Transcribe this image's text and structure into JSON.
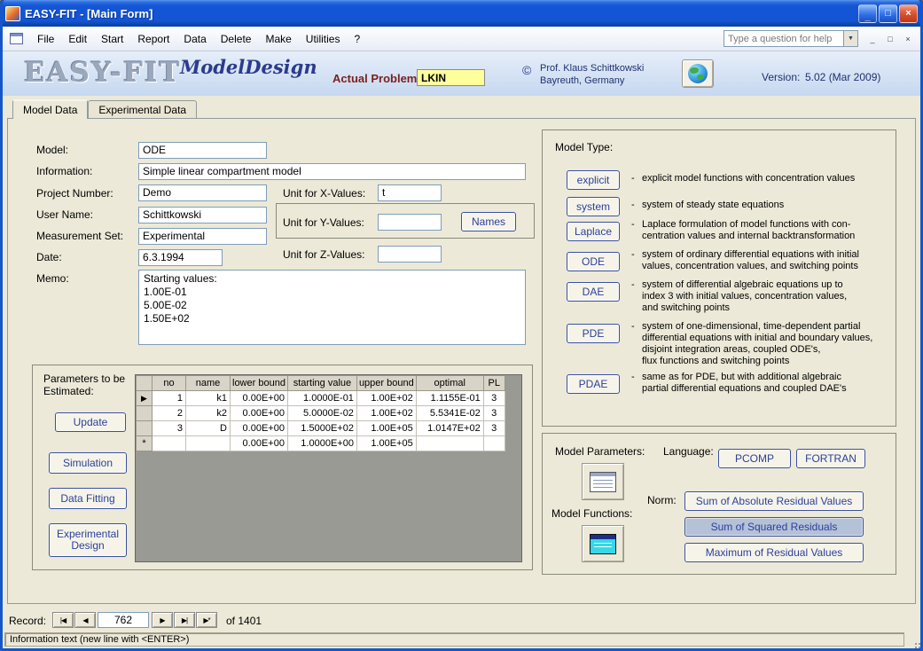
{
  "window": {
    "title": "EASY-FIT - [Main Form]",
    "menu": [
      "File",
      "Edit",
      "Start",
      "Report",
      "Data",
      "Delete",
      "Make",
      "Utilities",
      "?"
    ],
    "help_placeholder": "Type a question for help",
    "controls": {
      "minimize": "_",
      "maximize": "□",
      "close": "×"
    }
  },
  "header": {
    "logo": "EASY-FIT",
    "subtitle": "ModelDesign",
    "actual_problem_label": "Actual Problem:",
    "actual_problem_value": "LKIN",
    "copyright_symbol": "©",
    "author_line1": "Prof. Klaus Schittkowski",
    "author_line2": "Bayreuth, Germany",
    "version_label": "Version:",
    "version_value": "5.02 (Mar 2009)"
  },
  "tabs": [
    {
      "label": "Model Data"
    },
    {
      "label": "Experimental Data"
    }
  ],
  "form": {
    "model_label": "Model:",
    "model_value": "ODE",
    "information_label": "Information:",
    "information_value": "Simple linear compartment model",
    "project_label": "Project Number:",
    "project_value": "Demo",
    "user_label": "User Name:",
    "user_value": "Schittkowski",
    "measurement_label": "Measurement Set:",
    "measurement_value": "Experimental",
    "date_label": "Date:",
    "date_value": "6.3.1994",
    "memo_label": "Memo:",
    "memo_value": "Starting values:\n1.00E-01\n5.00E-02\n1.50E+02",
    "unit_x_label": "Unit for X-Values:",
    "unit_x_value": "t",
    "unit_y_label": "Unit for Y-Values:",
    "unit_y_value": "",
    "unit_z_label": "Unit for Z-Values:",
    "unit_z_value": "",
    "names_button": "Names"
  },
  "parameters": {
    "label": "Parameters to be Estimated:",
    "update_button": "Update",
    "simulation_button": "Simulation",
    "data_fitting_button": "Data Fitting",
    "experimental_design_button": "Experimental Design",
    "grid": {
      "columns": [
        "no",
        "name",
        "lower bound",
        "starting value",
        "upper bound",
        "optimal",
        "PL"
      ],
      "selectors": [
        "▶",
        "",
        "",
        "*"
      ],
      "rows": [
        [
          "1",
          "k1",
          "0.00E+00",
          "1.0000E-01",
          "1.00E+02",
          "1.1155E-01",
          "3"
        ],
        [
          "2",
          "k2",
          "0.00E+00",
          "5.0000E-02",
          "1.00E+02",
          "5.5341E-02",
          "3"
        ],
        [
          "3",
          "D",
          "0.00E+00",
          "1.5000E+02",
          "1.00E+05",
          "1.0147E+02",
          "3"
        ],
        [
          "",
          "",
          "0.00E+00",
          "1.0000E+00",
          "1.00E+05",
          "",
          ""
        ]
      ]
    }
  },
  "model_type": {
    "label": "Model Type:",
    "bullet": "-",
    "items": [
      {
        "button": "explicit",
        "desc": "explicit model functions with concentration values"
      },
      {
        "button": "system",
        "desc": "system of steady state equations"
      },
      {
        "button": "Laplace",
        "desc": "Laplace formulation of model functions with con-\ncentration values and internal backtransformation"
      },
      {
        "button": "ODE",
        "desc": "system of ordinary differential equations with initial\nvalues, concentration values, and switching points"
      },
      {
        "button": "DAE",
        "desc": "system of differential algebraic equations up to\nindex 3 with initial values, concentration values,\nand switching points"
      },
      {
        "button": "PDE",
        "desc": "system of one-dimensional, time-dependent  partial\ndifferential  equations with initial and boundary values,\ndisjoint integration areas, coupled ODE's,\nflux functions and switching points"
      },
      {
        "button": "PDAE",
        "desc": "same as for PDE, but with additional algebraic\npartial differential equations and coupled DAE's"
      }
    ]
  },
  "options": {
    "model_parameters_label": "Model Parameters:",
    "model_functions_label": "Model Functions:",
    "language_label": "Language:",
    "pcomp_button": "PCOMP",
    "fortran_button": "FORTRAN",
    "norm_label": "Norm:",
    "norm_buttons": [
      "Sum of Absolute Residual Values",
      "Sum of Squared Residuals",
      "Maximum of Residual Values"
    ],
    "selected_norm": "Sum of Squared Residuals"
  },
  "record_bar": {
    "label": "Record:",
    "value": "762",
    "total": "of 1401",
    "icons": {
      "first": "|◀",
      "prev": "◀",
      "next": "▶",
      "last": "▶|",
      "new": "▶*"
    }
  },
  "status_bar": {
    "text": "Information text (new line with <ENTER>)"
  }
}
